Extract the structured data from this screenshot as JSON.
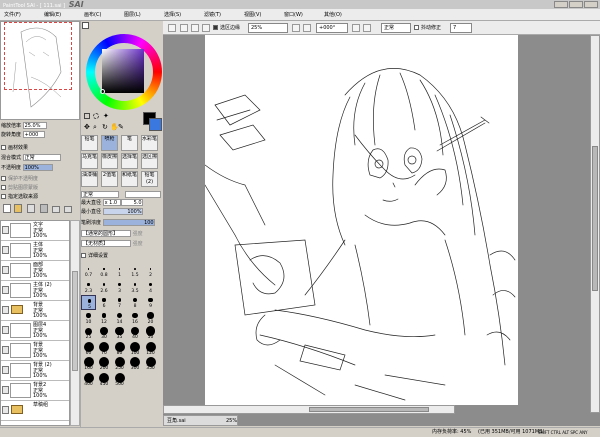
{
  "window": {
    "title": "PaintTool SAI - [ 111.sai ]",
    "logo": "SAI"
  },
  "menu": [
    "文件(F)",
    "编辑(E)",
    "画布(C)",
    "图层(L)",
    "选择(S)",
    "滤镜(T)",
    "视图(V)",
    "窗口(W)",
    "其他(O)"
  ],
  "toolbar": {
    "check_selection": "选区边缘",
    "zoom": "25%",
    "angle": "+000°",
    "blend": "正常",
    "stabilizer_label": "抖动修正",
    "stabilizer_value": "7"
  },
  "navigator": {
    "zoom_label": "缩放倍率",
    "zoom_value": "25.0%",
    "rotate_label": "旋转角度",
    "rotate_value": "+000"
  },
  "layer_props": {
    "texture": "画材效果",
    "blend_mode_label": "混合模式",
    "blend_mode_value": "正常",
    "opacity_label": "不透明度",
    "opacity_value": "100%",
    "protect_alpha": "保护不透明度",
    "clip_group": "剪贴图层蒙版",
    "selection_source": "指定选取来源"
  },
  "layers": [
    {
      "name": "文字",
      "mode": "正常",
      "opacity": "100%",
      "type": "layer",
      "selected": false
    },
    {
      "name": "主体",
      "mode": "正常",
      "opacity": "100%",
      "type": "layer",
      "selected": false
    },
    {
      "name": "面部",
      "mode": "正常",
      "opacity": "100%",
      "type": "layer",
      "selected": false
    },
    {
      "name": "主体 (2)",
      "mode": "正常",
      "opacity": "100%",
      "type": "layer",
      "selected": false
    },
    {
      "name": "背景",
      "mode": "正常",
      "opacity": "100%",
      "type": "folder",
      "selected": false
    },
    {
      "name": "图层4",
      "mode": "正常",
      "opacity": "100%",
      "type": "layer",
      "selected": false
    },
    {
      "name": "背景",
      "mode": "正常",
      "opacity": "100%",
      "type": "layer",
      "selected": false
    },
    {
      "name": "背景 (2)",
      "mode": "正常",
      "opacity": "100%",
      "type": "layer",
      "selected": false
    },
    {
      "name": "背景2",
      "mode": "正常",
      "opacity": "100%",
      "type": "layer",
      "selected": false
    },
    {
      "name": "草稿组",
      "mode": "",
      "opacity": "",
      "type": "folder",
      "selected": false
    }
  ],
  "tools": [
    [
      "铅笔",
      "喷枪",
      "笔",
      "水彩笔"
    ],
    [
      "马克笔",
      "橡皮擦",
      "选择笔",
      "选区擦"
    ],
    [
      "油漆桶",
      "2值笔",
      "和纸笔",
      "铅笔(2)"
    ]
  ],
  "brush": {
    "mode": "正常",
    "size_label": "最大直径",
    "size_mult": "x 1.0",
    "size_value": "5.0",
    "min_label": "最小直径",
    "min_value": "100%",
    "density_label": "笔刷浓度",
    "density_value": "100",
    "paper": "【通常的圆形】",
    "paper_strength": "强度",
    "texture": "【无材质】",
    "texture_strength": "强度",
    "detail": "详细设置"
  },
  "brush_sizes": [
    "0.7",
    "0.8",
    "1",
    "1.5",
    "2",
    "2.3",
    "2.6",
    "3",
    "3.5",
    "4",
    "5",
    "6",
    "7",
    "8",
    "9",
    "10",
    "12",
    "14",
    "16",
    "20",
    "25",
    "30",
    "35",
    "40",
    "50",
    "60",
    "70",
    "80",
    "100",
    "120",
    "160",
    "200",
    "250",
    "300",
    "350",
    "400",
    "450",
    "500"
  ],
  "selected_brush_size": "5",
  "canvas_tab": {
    "name": "豆角.sai",
    "zoom": "25%"
  },
  "status": {
    "memory": "内存负荷率: 45%",
    "usage": "(已用 351MB/可用 1071MB)",
    "keys": "SHIFT CTRL ALT SPC ANY"
  }
}
